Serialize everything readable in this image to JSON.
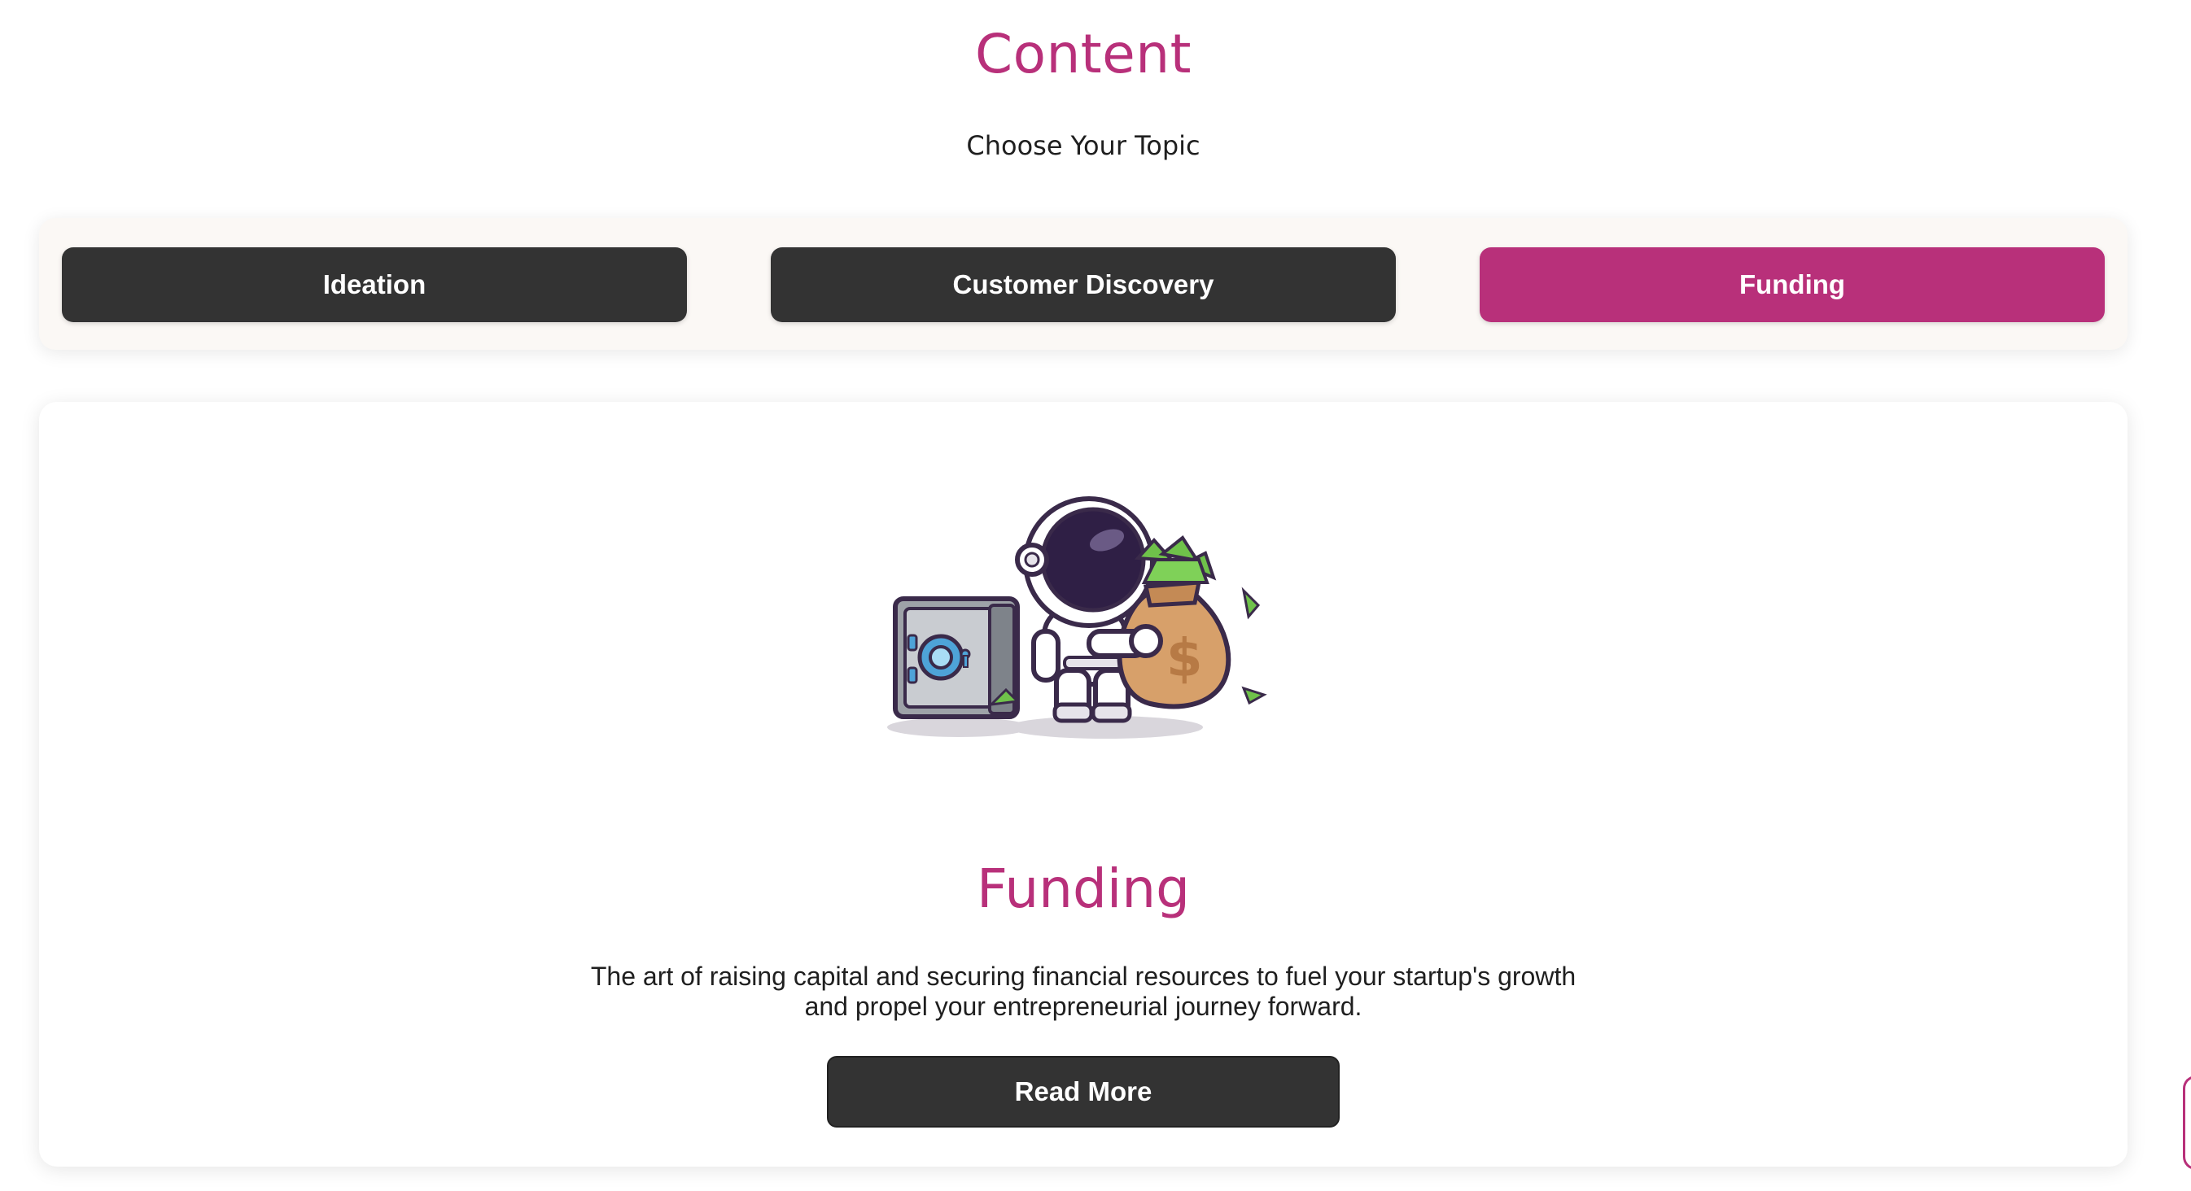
{
  "header": {
    "title": "Content",
    "subtitle": "Choose Your Topic"
  },
  "tabs": [
    {
      "label": "Ideation",
      "active": false
    },
    {
      "label": "Customer Discovery",
      "active": false
    },
    {
      "label": "Funding",
      "active": true
    }
  ],
  "card": {
    "illustration_icon": "astronaut-with-safe-and-money-bag",
    "title": "Funding",
    "description": "The art of raising capital and securing financial resources to fuel your startup's growth and propel your entrepreneurial journey forward.",
    "read_more_label": "Read More"
  },
  "colors": {
    "accent": "#b8307a",
    "button_dark": "#333333",
    "tab_bar_bg": "#fbf8f5",
    "text": "#1f1f1f"
  }
}
